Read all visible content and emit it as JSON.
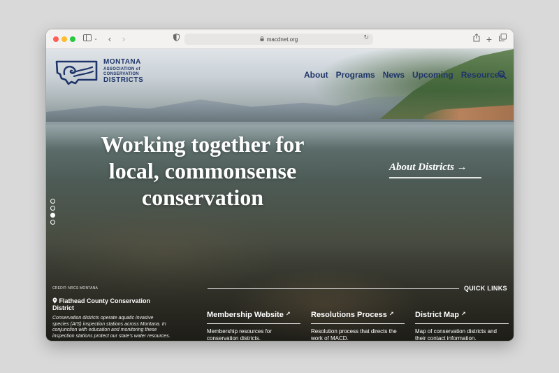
{
  "browser": {
    "url": "macdnet.org",
    "icons": [
      "close-dot",
      "minimize-dot",
      "zoom-dot",
      "sidebar-icon",
      "chevron-down-icon",
      "back-arrow-icon",
      "forward-arrow-icon",
      "shield-icon",
      "lock-icon",
      "reload-icon",
      "share-icon",
      "new-tab-icon",
      "tabs-overview-icon"
    ]
  },
  "site": {
    "logo": {
      "line1": "MONTANA",
      "line2": "ASSOCIATION of",
      "line3": "CONSERVATION",
      "line4": "DISTRICTS"
    },
    "nav": [
      {
        "label": "About"
      },
      {
        "label": "Programs"
      },
      {
        "label": "News"
      },
      {
        "label": "Upcoming"
      },
      {
        "label": "Resources"
      }
    ],
    "brand_color": "#1f3569"
  },
  "hero": {
    "headline": "Working together for local, commonsense conservation",
    "cta_label": "About Districts →",
    "slides": {
      "count": 4,
      "active_index": 2
    }
  },
  "photo_info": {
    "credit": "CREDIT: NRCS MONTANA",
    "location": "Flathead County Conservation District",
    "description": "Conservation districts operate aquatic invasive species (AIS) inspection stations across Montana. In conjunction with education and monitoring these inspection stations protect our state's water resources."
  },
  "quick_links": {
    "label": "QUICK LINKS",
    "items": [
      {
        "title": "Membership Website",
        "desc": "Membership resources for conservation districts."
      },
      {
        "title": "Resolutions Process",
        "desc": "Resolution process that directs the work of MACD."
      },
      {
        "title": "District Map",
        "desc": "Map of conservation districts and their contact information."
      }
    ]
  }
}
